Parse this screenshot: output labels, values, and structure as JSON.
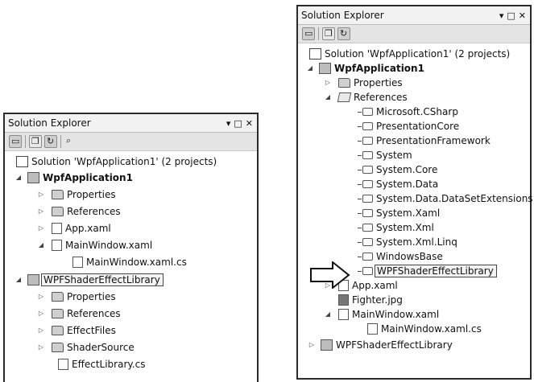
{
  "left_panel": {
    "title": "Solution Explorer",
    "controls": [
      "▾",
      "□",
      "✕"
    ],
    "toolbar": [
      "properties-icon",
      "show-all-files-icon",
      "refresh-icon",
      "class-view-icon"
    ],
    "tree": [
      {
        "label": "Solution 'WpfApplication1' (2 projects)",
        "icon": "solution-icon",
        "expander": ""
      },
      {
        "label": "WpfApplication1",
        "icon": "csharp-project-icon",
        "expander": "◢",
        "bold": true
      },
      {
        "label": "Properties",
        "icon": "properties-folder-icon",
        "expander": "▷"
      },
      {
        "label": "References",
        "icon": "references-folder-icon",
        "expander": "▷"
      },
      {
        "label": "App.xaml",
        "icon": "xaml-file-icon",
        "expander": "▷"
      },
      {
        "label": "MainWindow.xaml",
        "icon": "xaml-file-icon",
        "expander": "◢"
      },
      {
        "label": "MainWindow.xaml.cs",
        "icon": "csharp-file-icon",
        "expander": ""
      },
      {
        "label": "WPFShaderEffectLibrary",
        "icon": "csharp-project-icon",
        "expander": "◢",
        "selected": true
      },
      {
        "label": "Properties",
        "icon": "properties-folder-icon",
        "expander": "▷"
      },
      {
        "label": "References",
        "icon": "references-folder-icon",
        "expander": "▷"
      },
      {
        "label": "EffectFiles",
        "icon": "folder-icon",
        "expander": "▷"
      },
      {
        "label": "ShaderSource",
        "icon": "folder-icon",
        "expander": "▷"
      },
      {
        "label": "EffectLibrary.cs",
        "icon": "csharp-file-icon",
        "expander": ""
      }
    ]
  },
  "right_panel": {
    "title": "Solution Explorer",
    "controls": [
      "▾",
      "□",
      "✕"
    ],
    "toolbar": [
      "properties-icon",
      "show-all-files-icon",
      "refresh-icon"
    ],
    "tree": [
      {
        "label": "Solution 'WpfApplication1' (2 projects)",
        "icon": "solution-icon",
        "expander": ""
      },
      {
        "label": "WpfApplication1",
        "icon": "csharp-project-icon",
        "expander": "◢",
        "bold": true
      },
      {
        "label": "Properties",
        "icon": "properties-folder-icon",
        "expander": "▷"
      },
      {
        "label": "References",
        "icon": "references-folder-icon",
        "expander": "◢"
      },
      {
        "label": "Microsoft.CSharp",
        "icon": "reference-icon",
        "expander": ""
      },
      {
        "label": "PresentationCore",
        "icon": "reference-icon",
        "expander": ""
      },
      {
        "label": "PresentationFramework",
        "icon": "reference-icon",
        "expander": ""
      },
      {
        "label": "System",
        "icon": "reference-icon",
        "expander": ""
      },
      {
        "label": "System.Core",
        "icon": "reference-icon",
        "expander": ""
      },
      {
        "label": "System.Data",
        "icon": "reference-icon",
        "expander": ""
      },
      {
        "label": "System.Data.DataSetExtensions",
        "icon": "reference-icon",
        "expander": ""
      },
      {
        "label": "System.Xaml",
        "icon": "reference-icon",
        "expander": ""
      },
      {
        "label": "System.Xml",
        "icon": "reference-icon",
        "expander": ""
      },
      {
        "label": "System.Xml.Linq",
        "icon": "reference-icon",
        "expander": ""
      },
      {
        "label": "WindowsBase",
        "icon": "reference-icon",
        "expander": ""
      },
      {
        "label": "WPFShaderEffectLibrary",
        "icon": "reference-icon",
        "expander": "",
        "selected": true
      },
      {
        "label": "App.xaml",
        "icon": "xaml-file-icon",
        "expander": "▷"
      },
      {
        "label": "Fighter.jpg",
        "icon": "image-file-icon",
        "expander": ""
      },
      {
        "label": "MainWindow.xaml",
        "icon": "xaml-file-icon",
        "expander": "◢"
      },
      {
        "label": "MainWindow.xaml.cs",
        "icon": "csharp-file-icon",
        "expander": ""
      },
      {
        "label": "WPFShaderEffectLibrary",
        "icon": "csharp-project-icon",
        "expander": "▷"
      }
    ]
  }
}
